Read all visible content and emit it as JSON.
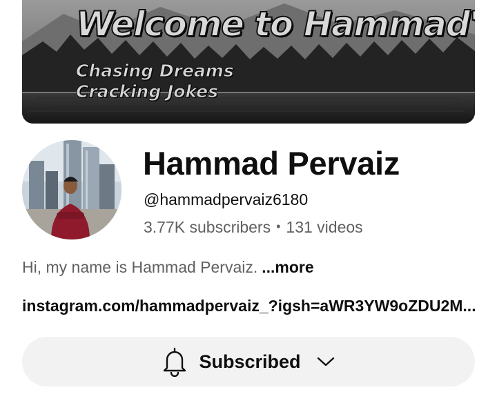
{
  "banner": {
    "title": "Welcome to Hammad's Life",
    "line1": "Chasing Dreams",
    "line2": "Cracking Jokes"
  },
  "channel": {
    "name": "Hammad Pervaiz",
    "handle": "@hammadpervaiz6180",
    "subscribers": "3.77K subscribers",
    "separator": "•",
    "videos": "131 videos"
  },
  "description": {
    "text": "Hi, my name is Hammad Pervaiz.",
    "more": "...more"
  },
  "link": {
    "text": "instagram.com/hammadpervaiz_?igsh=aWR3YW9oZDU2M..."
  },
  "subscribe_button": {
    "label": "Subscribed",
    "icon": "bell-icon",
    "dropdown_icon": "chevron-down-icon",
    "background": "#f2f2f2"
  }
}
